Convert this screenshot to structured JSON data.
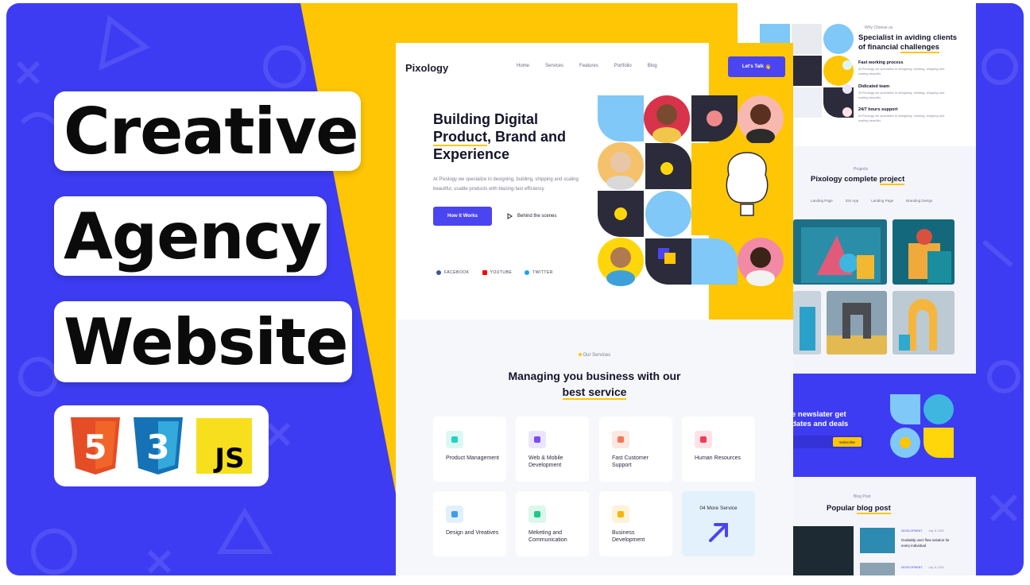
{
  "thumbnail": {
    "title_lines": [
      "Creative",
      "Agency",
      "Website"
    ],
    "tech_logos": [
      {
        "name": "html5-logo",
        "label": "5",
        "color": "#e44d26"
      },
      {
        "name": "css3-logo",
        "label": "3",
        "color": "#2a65f1"
      },
      {
        "name": "js-logo",
        "label": "JS",
        "color": "#f7df1e"
      }
    ],
    "colors": {
      "accent_blue": "#3d3cf2",
      "accent_yellow": "#fec604"
    }
  },
  "site": {
    "brand": "Pixology",
    "nav": [
      "Home",
      "Services",
      "Features",
      "Portfolio",
      "Blog"
    ],
    "cta": "Let's Talk",
    "hero": {
      "title_line1": "Building Digital",
      "title_line2a": "Product",
      "title_line2b": ", Brand and",
      "title_line3": "Experience",
      "description": "At Pixology we specialize in designing, building, shipping and scaling beautiful, usable products with blazing-fast efficiency",
      "primary_button": "How It Works",
      "secondary_button": "Behind the scenes",
      "social": [
        "FACEBOOK",
        "YOUTUBE",
        "TWITTER"
      ]
    },
    "services": {
      "tag": "Our Services",
      "title_line1": "Managing you business with our",
      "title_line2": "best service",
      "items": [
        {
          "label": "Product Management",
          "color": "#22d3c5",
          "bg": "#dcf8f5"
        },
        {
          "label": "Web & Mobile Development",
          "color": "#7b4cf2",
          "bg": "#ece6fd"
        },
        {
          "label": "Fast Customer Support",
          "color": "#f07a5a",
          "bg": "#fde7e1"
        },
        {
          "label": "Human Resources",
          "color": "#ef3d5a",
          "bg": "#fde3e7"
        },
        {
          "label": "Design and Vreatives",
          "color": "#3b9cf2",
          "bg": "#e2f0fd"
        },
        {
          "label": "Meketing and Communication",
          "color": "#1ec98a",
          "bg": "#dcf7ec"
        },
        {
          "label": "Business Development",
          "color": "#f7b500",
          "bg": "#fdf3d8"
        }
      ],
      "more": "04 More Service"
    }
  },
  "site2": {
    "why_tag": "Why Choose us",
    "why_title_line1": "Specialist in aviding clients",
    "why_title_line2a": "of financial ",
    "why_title_line2b": "challenges",
    "features": [
      {
        "title": "Fast working process",
        "desc": "At Pixology we specialize in designing, building, shipping and scaling beautifu.",
        "color": "#22d3c5"
      },
      {
        "title": "Didicated team",
        "desc": "At Pixology we specialize in designing, building, shipping and scaling beautifu.",
        "color": "#7b4cf2"
      },
      {
        "title": "24/7 hours support",
        "desc": "At Pixology we specialize in designing, building, shipping and scaling beautifu.",
        "color": "#ef3d5a"
      }
    ],
    "projects_tag": "Projects",
    "projects_title_a": "Pixology complete ",
    "projects_title_b": "project",
    "project_tabs": [
      "Landing Page",
      "iOS App",
      "Landing Page",
      "Branding Design"
    ],
    "newsletter_line1": "e newslater get",
    "newsletter_line2": "dates and deals",
    "subscribe": "Subscribe",
    "blog_tag": "Blog Post",
    "blog_title_a": "Popular ",
    "blog_title_b": "blog post",
    "posts": [
      {
        "category": "DEVELOPMENT",
        "date": "July 11 2020",
        "title": "Godaddy user flow solution for every individual"
      },
      {
        "category": "DEVELOPMENT",
        "date": "July 11 2020",
        "title": ""
      }
    ]
  }
}
